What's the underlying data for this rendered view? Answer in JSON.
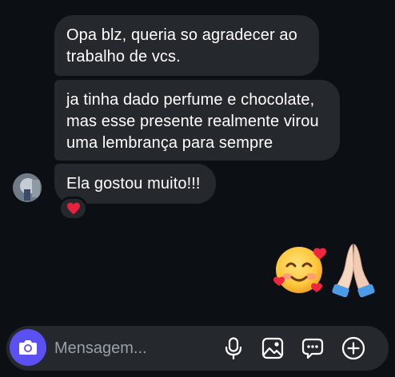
{
  "conversation": {
    "messages": [
      {
        "lines": [
          "Opa blz, queria so agradecer ao",
          "trabalho de vcs."
        ]
      },
      {
        "lines": [
          "ja tinha dado perfume e chocolate,",
          "mas esse presente realmente virou",
          "uma lembrança para sempre"
        ]
      },
      {
        "lines": [
          "Ela gostou muito!!!"
        ],
        "reaction": "red-heart"
      }
    ],
    "sent_emojis": [
      "smiling-face-with-hearts",
      "folded-hands"
    ]
  },
  "composer": {
    "placeholder": "Mensagem..."
  },
  "icons": {
    "camera": "camera-icon",
    "mic": "microphone-icon",
    "gallery": "image-icon",
    "sticker": "chat-bubble-icon",
    "more": "add-icon"
  },
  "colors": {
    "background": "#0c0f14",
    "bubble": "#25282d",
    "accent": "#5b51f2",
    "heart": "#e8223a"
  }
}
